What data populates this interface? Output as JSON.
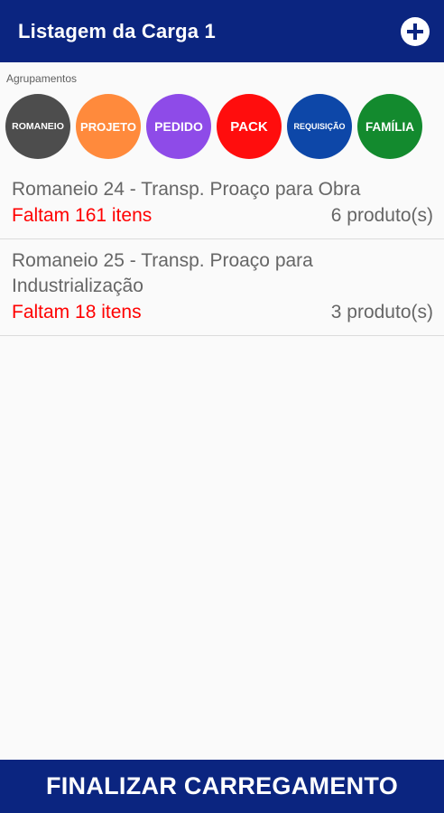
{
  "header": {
    "title": "Listagem da Carga 1",
    "add_icon": "plus-circle-icon"
  },
  "groupings": {
    "label": "Agrupamentos",
    "chips": [
      {
        "label": "ROMANEIO",
        "color": "#4d4d4d"
      },
      {
        "label": "PROJETO",
        "color": "#ff8a3c"
      },
      {
        "label": "PEDIDO",
        "color": "#8e4be8"
      },
      {
        "label": "PACK",
        "color": "#ff0d0d"
      },
      {
        "label": "REQUISIÇÃO",
        "color": "#0d47a8"
      },
      {
        "label": "FAMÍLIA",
        "color": "#138a2e"
      }
    ]
  },
  "items": [
    {
      "title": "Romaneio 24  - Transp. Proaço para Obra",
      "missing": "Faltam 161 itens",
      "count": "6 produto(s)"
    },
    {
      "title": "Romaneio 25  - Transp. Proaço para Industrialização",
      "missing": "Faltam 18 itens",
      "count": "3 produto(s)"
    }
  ],
  "footer": {
    "button_label": "FINALIZAR CARREGAMENTO"
  },
  "colors": {
    "primary": "#0b2580",
    "missing_text": "#ff0000",
    "muted_text": "#666666"
  }
}
